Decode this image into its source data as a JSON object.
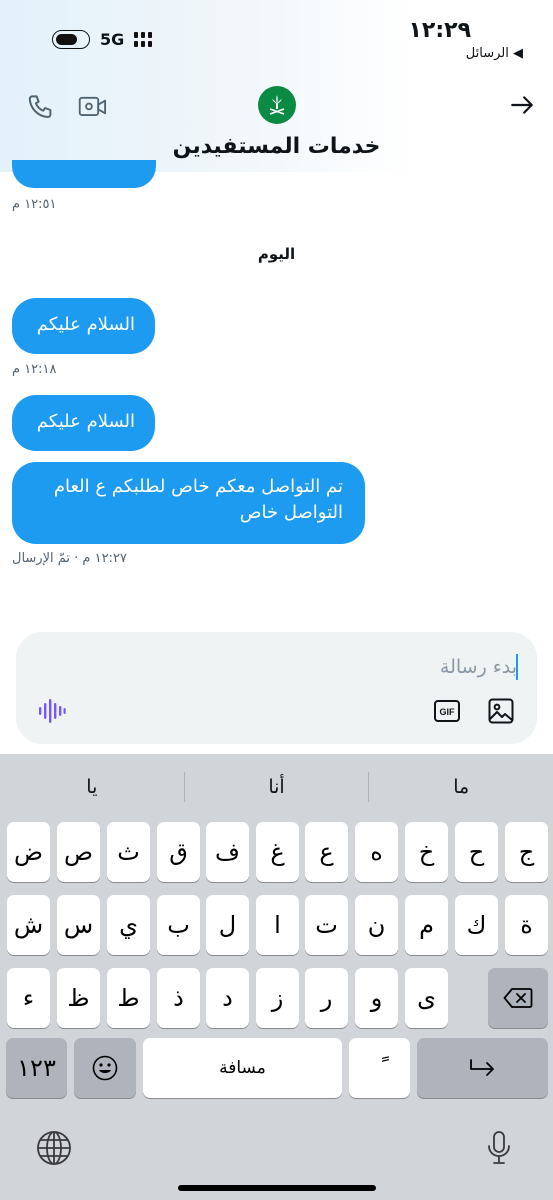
{
  "status": {
    "time": "١٢:٢٩",
    "back_label": "◀ الرسائل",
    "network": "5G"
  },
  "header": {
    "title": "خدمات المستفيدين"
  },
  "messages": {
    "previous_time": "١٢:٥١ م",
    "day_separator": "اليوم",
    "items": [
      {
        "text": "السلام عليكم",
        "time": "١٢:١٨ م"
      },
      {
        "text": "السلام عليكم"
      },
      {
        "text": "تم التواصل معكم خاص لطلبكم ع العام التواصل خاص",
        "time": "١٢:٢٧ م · تمّ الإرسال"
      }
    ]
  },
  "composer": {
    "placeholder": "بدء رسالة",
    "gif_label": "GIF"
  },
  "keyboard": {
    "suggestions": [
      "ما",
      "أنا",
      "يا"
    ],
    "row1": [
      "ج",
      "ح",
      "خ",
      "ه",
      "ع",
      "غ",
      "ف",
      "ق",
      "ث",
      "ص",
      "ض"
    ],
    "row2": [
      "ة",
      "ك",
      "م",
      "ن",
      "ت",
      "ا",
      "ل",
      "ب",
      "ي",
      "س",
      "ش"
    ],
    "row3": [
      "ى",
      "و",
      "ر",
      "ز",
      "د",
      "ذ",
      "ط",
      "ظ",
      "ء"
    ],
    "numbers_label": "١٢٣",
    "space_label": "مسافة",
    "tanween_label": "ً"
  },
  "colors": {
    "accent": "#1d9bf0",
    "keyboard_bg": "#d1d4d9",
    "voice": "#7856ff"
  }
}
